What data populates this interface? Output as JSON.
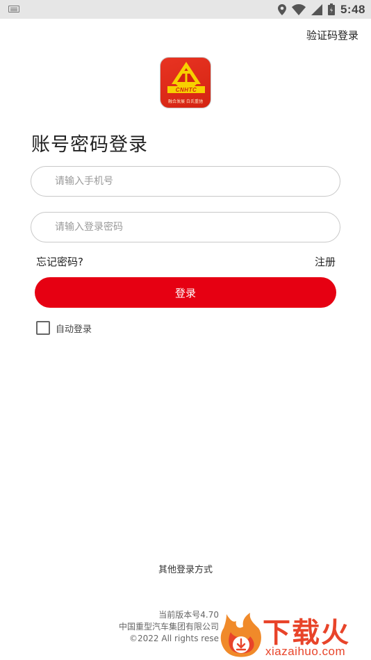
{
  "status_bar": {
    "time": "5:48",
    "icons": [
      "keyboard-icon",
      "location-icon",
      "wifi-icon",
      "signal-icon",
      "battery-icon"
    ]
  },
  "header": {
    "sms_login_label": "验证码登录"
  },
  "logo": {
    "caption": "融合发展 白氏重驰"
  },
  "form": {
    "title": "账号密码登录",
    "phone_placeholder": "请输入手机号",
    "password_placeholder": "请输入登录密码",
    "forgot_label": "忘记密码?",
    "register_label": "注册",
    "login_label": "登录",
    "auto_login_label": "自动登录",
    "auto_login_checked": false
  },
  "other_login_label": "其他登录方式",
  "footer": {
    "version": "当前版本号4.70",
    "company": "中国重型汽车集团有限公司",
    "copyright": "©2022 All rights rese"
  },
  "watermark": {
    "title": "下载火",
    "url": "xiazaihuo.com"
  },
  "colors": {
    "accent": "#e60012",
    "watermark": "#e8442a"
  }
}
